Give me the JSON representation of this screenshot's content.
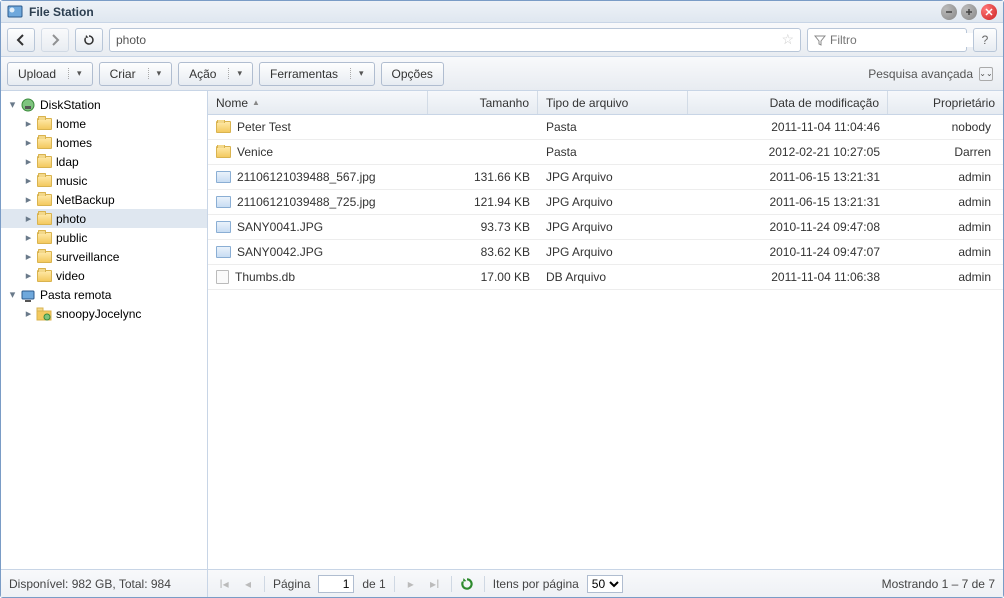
{
  "window": {
    "title": "File Station"
  },
  "nav": {
    "path_value": "photo",
    "filter_placeholder": "Filtro",
    "help_label": "?"
  },
  "toolbar": {
    "upload": "Upload",
    "create": "Criar",
    "action": "Ação",
    "tools": "Ferramentas",
    "options": "Opções",
    "advanced_search": "Pesquisa avançada"
  },
  "tree": {
    "root1": "DiskStation",
    "root1_items": [
      "home",
      "homes",
      "ldap",
      "music",
      "NetBackup",
      "photo",
      "public",
      "surveillance",
      "video"
    ],
    "root1_selected_index": 5,
    "root2": "Pasta remota",
    "root2_items": [
      "snoopyJocelync"
    ]
  },
  "columns": {
    "name": "Nome",
    "size": "Tamanho",
    "type": "Tipo de arquivo",
    "date": "Data de modificação",
    "owner": "Proprietário"
  },
  "rows": [
    {
      "icon": "folder",
      "name": "Peter Test",
      "size": "",
      "type": "Pasta",
      "date": "2011-11-04 11:04:46",
      "owner": "nobody"
    },
    {
      "icon": "folder",
      "name": "Venice",
      "size": "",
      "type": "Pasta",
      "date": "2012-02-21 10:27:05",
      "owner": "Darren"
    },
    {
      "icon": "image",
      "name": "211061210394​88_567.jpg",
      "size": "131.66 KB",
      "type": "JPG Arquivo",
      "date": "2011-06-15 13:21:31",
      "owner": "admin"
    },
    {
      "icon": "image",
      "name": "211061210394​88_725.jpg",
      "size": "121.94 KB",
      "type": "JPG Arquivo",
      "date": "2011-06-15 13:21:31",
      "owner": "admin"
    },
    {
      "icon": "image",
      "name": "SANY0041.JPG",
      "size": "93.73 KB",
      "type": "JPG Arquivo",
      "date": "2010-11-24 09:47:08",
      "owner": "admin"
    },
    {
      "icon": "image",
      "name": "SANY0042.JPG",
      "size": "83.62 KB",
      "type": "JPG Arquivo",
      "date": "2010-11-24 09:47:07",
      "owner": "admin"
    },
    {
      "icon": "db",
      "name": "Thumbs.db",
      "size": "17.00 KB",
      "type": "DB Arquivo",
      "date": "2011-11-04 11:06:38",
      "owner": "admin"
    }
  ],
  "status": {
    "disk": "Disponível: 982 GB, Total: 984",
    "page_label": "Página",
    "page_value": "1",
    "page_of": "de 1",
    "items_per_page_label": "Itens por página",
    "items_per_page_value": "50",
    "showing": "Mostrando 1 – 7 de 7"
  }
}
